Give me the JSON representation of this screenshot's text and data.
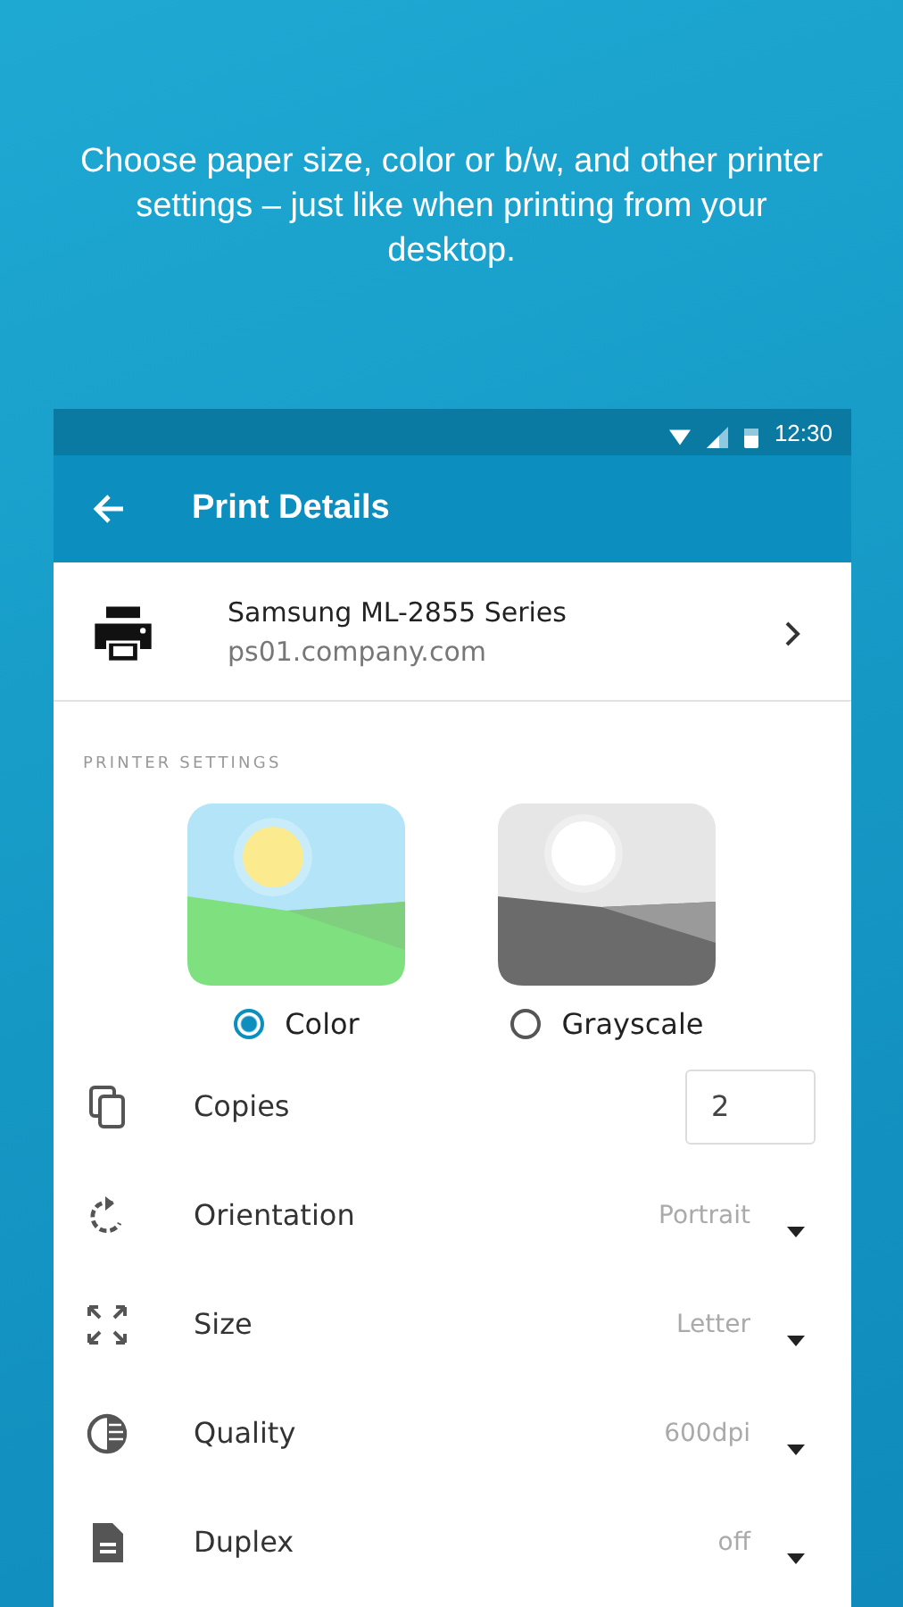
{
  "headline": "Choose paper size, color or b/w, and other printer settings – just like when printing from your desktop.",
  "status_bar": {
    "time": "12:30"
  },
  "app_bar": {
    "title": "Print Details"
  },
  "printer": {
    "name": "Samsung ML-2855 Series",
    "host": "ps01.company.com"
  },
  "section_label": "PRINTER SETTINGS",
  "color_modes": [
    {
      "label": "Color",
      "selected": true
    },
    {
      "label": "Grayscale",
      "selected": false
    }
  ],
  "settings": [
    {
      "kind": "input",
      "label": "Copies",
      "value": "2"
    },
    {
      "kind": "dropdown",
      "label": "Orientation",
      "value": "Portrait"
    },
    {
      "kind": "dropdown",
      "label": "Size",
      "value": "Letter"
    },
    {
      "kind": "dropdown",
      "label": "Quality",
      "value": "600dpi"
    },
    {
      "kind": "dropdown",
      "label": "Duplex",
      "value": "off"
    }
  ]
}
